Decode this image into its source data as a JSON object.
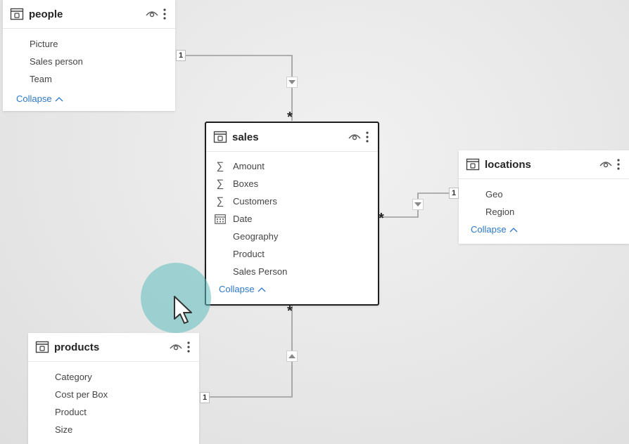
{
  "tables": {
    "people": {
      "title": "people",
      "fields": [
        {
          "label": "Picture",
          "icon": ""
        },
        {
          "label": "Sales person",
          "icon": ""
        },
        {
          "label": "Team",
          "icon": ""
        }
      ],
      "collapse_label": "Collapse"
    },
    "sales": {
      "title": "sales",
      "fields": [
        {
          "label": "Amount",
          "icon": "sigma-icon"
        },
        {
          "label": "Boxes",
          "icon": "sigma-icon"
        },
        {
          "label": "Customers",
          "icon": "sigma-icon"
        },
        {
          "label": "Date",
          "icon": "calendar-icon"
        },
        {
          "label": "Geography",
          "icon": ""
        },
        {
          "label": "Product",
          "icon": ""
        },
        {
          "label": "Sales Person",
          "icon": ""
        }
      ],
      "collapse_label": "Collapse"
    },
    "locations": {
      "title": "locations",
      "fields": [
        {
          "label": "Geo",
          "icon": ""
        },
        {
          "label": "Region",
          "icon": ""
        }
      ],
      "collapse_label": "Collapse"
    },
    "products": {
      "title": "products",
      "fields": [
        {
          "label": "Category",
          "icon": ""
        },
        {
          "label": "Cost per Box",
          "icon": ""
        },
        {
          "label": "Product",
          "icon": ""
        },
        {
          "label": "Size",
          "icon": ""
        }
      ]
    }
  },
  "relationships": {
    "people_sales": {
      "one": "1",
      "many": "*"
    },
    "sales_locations": {
      "one": "1",
      "many": "*"
    },
    "sales_products": {
      "one": "1",
      "many": "*"
    }
  },
  "colors": {
    "accent_link": "#2c78c8",
    "selected_border": "#1f1f1f",
    "cursor_halo": "#5fbebe"
  }
}
